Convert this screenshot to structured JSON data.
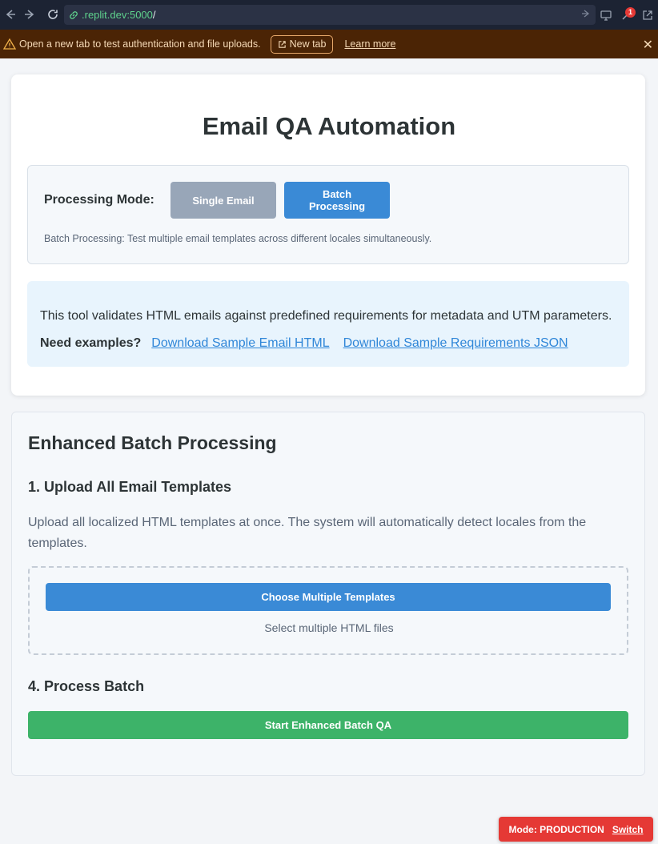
{
  "browser": {
    "url_host": ".replit.dev:5000",
    "url_path": "/",
    "notification_count": "1"
  },
  "banner": {
    "message": "Open a new tab to test authentication and file uploads.",
    "new_tab_label": "New tab",
    "learn_more_label": "Learn more",
    "close_label": "✕"
  },
  "header": {
    "title": "Email QA Automation"
  },
  "mode": {
    "label": "Processing Mode:",
    "single_label": "Single Email",
    "batch_label_line1": "Batch",
    "batch_label_line2": "Processing",
    "selected": "Batch Processing",
    "description": "Batch Processing: Test multiple email templates across different locales simultaneously."
  },
  "info": {
    "text": "This tool validates HTML emails against predefined requirements for metadata and UTM parameters.",
    "examples_label": "Need examples?",
    "sample_html_link": "Download Sample Email HTML",
    "sample_json_link": "Download Sample Requirements JSON"
  },
  "batch": {
    "title": "Enhanced Batch Processing",
    "step1_title": "1. Upload All Email Templates",
    "step1_desc": "Upload all localized HTML templates at once. The system will automatically detect locales from the templates.",
    "choose_label": "Choose Multiple Templates",
    "drop_hint": "Select multiple HTML files",
    "step4_title": "4. Process Batch",
    "start_label": "Start Enhanced Batch QA"
  },
  "footer": {
    "mode_text": "Mode: PRODUCTION",
    "switch_label": "Switch"
  },
  "colors": {
    "primary": "#3a8ad6",
    "success": "#3db369",
    "danger": "#e53935",
    "inactive": "#98a6b8",
    "banner_bg": "#4b2405"
  }
}
